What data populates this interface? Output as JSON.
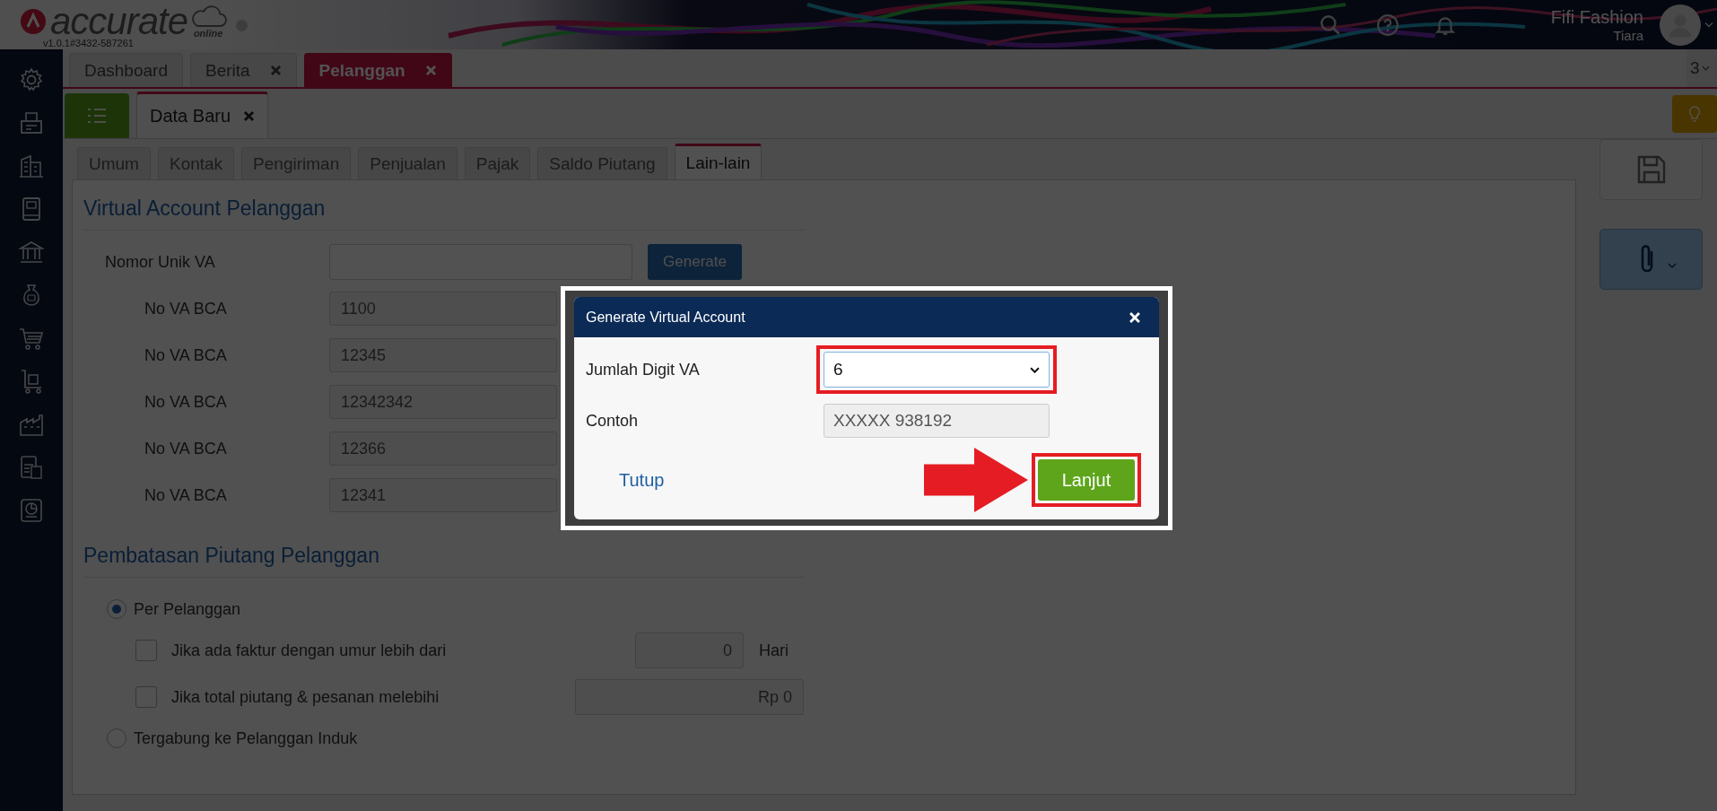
{
  "header": {
    "logo_text": "accurate",
    "logo_subtext": "online",
    "version": "v1.0.1#3432-587261",
    "company": "Fifi Fashion",
    "user": "Tiara"
  },
  "module_tabs": [
    {
      "label": "Dashboard",
      "selected": false,
      "closable": false
    },
    {
      "label": "Berita",
      "selected": false,
      "closable": true
    },
    {
      "label": "Pelanggan",
      "selected": true,
      "closable": true
    }
  ],
  "tab_count": "3",
  "page_tabs": [
    {
      "label": "Data Baru",
      "selected": true,
      "closable": true
    }
  ],
  "form_tabs": [
    {
      "label": "Umum",
      "selected": false
    },
    {
      "label": "Kontak",
      "selected": false
    },
    {
      "label": "Pengiriman",
      "selected": false
    },
    {
      "label": "Penjualan",
      "selected": false
    },
    {
      "label": "Pajak",
      "selected": false
    },
    {
      "label": "Saldo Piutang",
      "selected": false
    },
    {
      "label": "Lain-lain",
      "selected": true
    }
  ],
  "virtual_account": {
    "title": "Virtual Account Pelanggan",
    "unique_number": {
      "label": "Nomor Unik VA",
      "button": "Generate"
    },
    "accounts": [
      {
        "label": "No VA BCA",
        "value": "1100"
      },
      {
        "label": "No VA BCA",
        "value": "12345"
      },
      {
        "label": "No VA BCA",
        "value": "12342342"
      },
      {
        "label": "No VA BCA",
        "value": "12366"
      },
      {
        "label": "No VA BCA",
        "value": "12341"
      }
    ]
  },
  "receivable_limit": {
    "title": "Pembatasan Piutang Pelanggan",
    "options": [
      {
        "label": "Per Pelanggan",
        "selected": true,
        "children": [
          {
            "label": "Jika ada faktur dengan umur lebih dari",
            "checked": false,
            "value": "0",
            "unit": "Hari"
          },
          {
            "label": "Jika total piutang & pesanan melebihi",
            "checked": false,
            "value": "Rp 0"
          }
        ]
      },
      {
        "label": "Tergabung ke Pelanggan Induk",
        "selected": false
      }
    ]
  },
  "dialog": {
    "title": "Generate Virtual Account",
    "fields": [
      {
        "kind": "select",
        "label": "Jumlah Digit VA",
        "value": "6",
        "highlighted": true
      },
      {
        "kind": "readonly",
        "label": "Contoh",
        "value": "XXXXX 938192",
        "highlighted": false
      }
    ],
    "close_link": "Tutup",
    "primary_button": {
      "label": "Lanjut",
      "highlighted": true
    },
    "pointer_arrow": true
  }
}
